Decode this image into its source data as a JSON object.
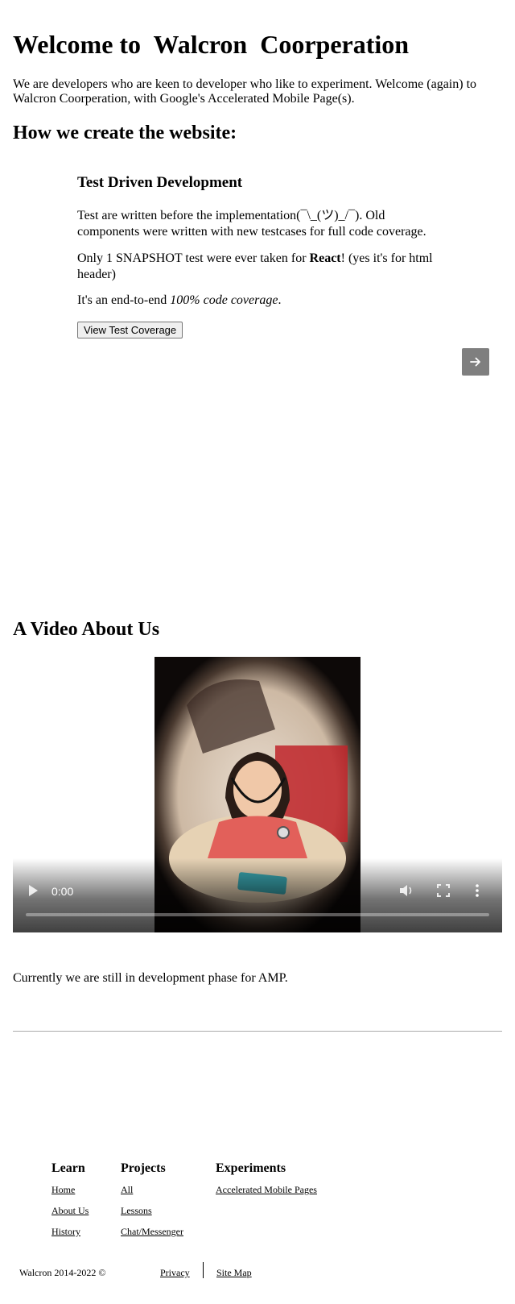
{
  "header": {
    "title": "Welcome to  Walcron  Coorperation",
    "intro": "We are developers who are keen to developer who like to experiment. Welcome (again) to Walcron Coorperation, with Google's Accelerated Mobile Page(s)."
  },
  "how": {
    "heading": "How we create the website:",
    "slide": {
      "title": "Test Driven Development",
      "p1": "Test are written before the implementation(¯\\_(ツ)_/¯). Old components were written with new testcases for full code coverage.",
      "p2_before": "Only 1 SNAPSHOT test were ever taken for ",
      "p2_bold": "React",
      "p2_after": "! (yes it's for html header)",
      "p3_before": "It's an end-to-end ",
      "p3_italic": "100% code coverage",
      "p3_after": ".",
      "button": "View Test Coverage"
    },
    "next_icon": "arrow-right-icon"
  },
  "video": {
    "heading": "A Video About Us",
    "time": "0:00",
    "icons": [
      "play-icon",
      "volume-icon",
      "fullscreen-icon",
      "more-options-icon"
    ]
  },
  "status": "Currently we are still in development phase for AMP.",
  "footer": {
    "learn": {
      "title": "Learn",
      "links": [
        "Home",
        "About Us",
        "History"
      ]
    },
    "projects": {
      "title": "Projects",
      "links": [
        "All",
        "Lessons",
        "Chat/Messenger"
      ]
    },
    "experiments": {
      "title": "Experiments",
      "links": [
        "Accelerated Mobile Pages"
      ]
    },
    "copyright": "Walcron 2014-2022 ©",
    "privacy": "Privacy",
    "sitemap": "Site Map"
  }
}
